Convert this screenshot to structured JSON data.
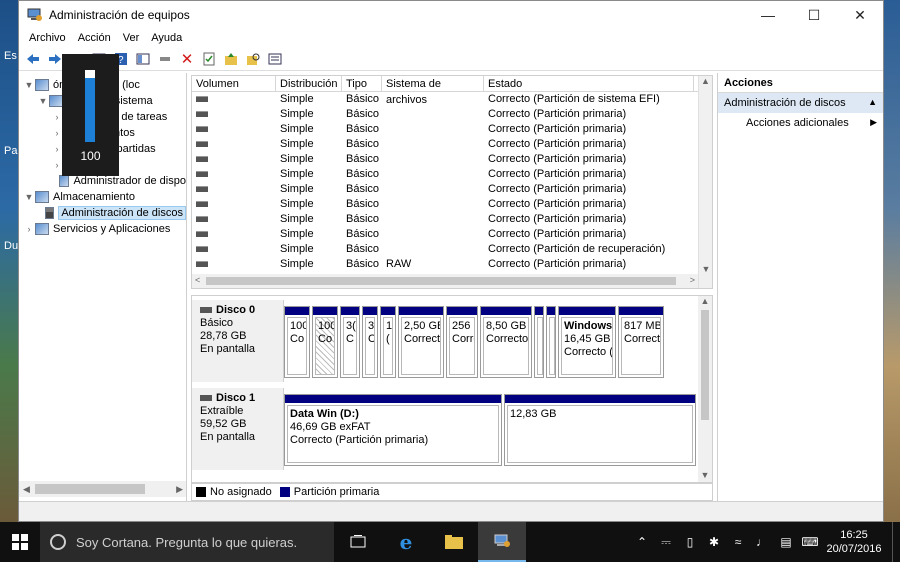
{
  "window": {
    "title": "Administración de equipos"
  },
  "desktop": {
    "left_labels": [
      "Es",
      "Pa",
      "Du"
    ]
  },
  "menu": [
    "Archivo",
    "Acción",
    "Ver",
    "Ayuda"
  ],
  "volume_osd": {
    "value": "100",
    "level": 1.0
  },
  "tree": [
    {
      "label": "ón del equipo (loc",
      "arrow": "▼",
      "icon": "computer-icon",
      "indent": 0
    },
    {
      "label": "entas del sistema",
      "arrow": "▼",
      "icon": "tools-icon",
      "indent": 1
    },
    {
      "label": "amador de tareas",
      "arrow": "›",
      "icon": "clock-icon",
      "indent": 2
    },
    {
      "label": "de eventos",
      "arrow": "›",
      "icon": "event-icon",
      "indent": 2
    },
    {
      "label": "as compartidas",
      "arrow": "›",
      "icon": "folder-icon",
      "indent": 2
    },
    {
      "label": "miento",
      "arrow": "›",
      "icon": "perf-icon",
      "indent": 2
    },
    {
      "label": "Administrador de dispo",
      "arrow": "",
      "icon": "device-icon",
      "indent": 2
    },
    {
      "label": "Almacenamiento",
      "arrow": "▼",
      "icon": "storage-icon",
      "indent": 0
    },
    {
      "label": "Administración de discos",
      "arrow": "",
      "icon": "disk-icon",
      "indent": 1,
      "selected": true
    },
    {
      "label": "Servicios y Aplicaciones",
      "arrow": "›",
      "icon": "services-icon",
      "indent": 0
    }
  ],
  "volumes": {
    "headers": [
      "Volumen",
      "Distribución",
      "Tipo",
      "Sistema de archivos",
      "Estado"
    ],
    "rows": [
      [
        "",
        "Simple",
        "Básico",
        "",
        "Correcto (Partición de sistema EFI)"
      ],
      [
        "",
        "Simple",
        "Básico",
        "",
        "Correcto (Partición primaria)"
      ],
      [
        "",
        "Simple",
        "Básico",
        "",
        "Correcto (Partición primaria)"
      ],
      [
        "",
        "Simple",
        "Básico",
        "",
        "Correcto (Partición primaria)"
      ],
      [
        "",
        "Simple",
        "Básico",
        "",
        "Correcto (Partición primaria)"
      ],
      [
        "",
        "Simple",
        "Básico",
        "",
        "Correcto (Partición primaria)"
      ],
      [
        "",
        "Simple",
        "Básico",
        "",
        "Correcto (Partición primaria)"
      ],
      [
        "",
        "Simple",
        "Básico",
        "",
        "Correcto (Partición primaria)"
      ],
      [
        "",
        "Simple",
        "Básico",
        "",
        "Correcto (Partición primaria)"
      ],
      [
        "",
        "Simple",
        "Básico",
        "",
        "Correcto (Partición primaria)"
      ],
      [
        "",
        "Simple",
        "Básico",
        "",
        "Correcto (Partición de recuperación)"
      ],
      [
        "",
        "Simple",
        "Básico",
        "RAW",
        "Correcto (Partición primaria)"
      ]
    ]
  },
  "disks": [
    {
      "name": "Disco 0",
      "type": "Básico",
      "size": "28,78 GB",
      "status": "En pantalla",
      "partitions": [
        {
          "l1": "100",
          "l2": "Co",
          "w": 26
        },
        {
          "l1": "100",
          "l2": "Co",
          "w": 26,
          "hatched": true
        },
        {
          "l1": "3(",
          "l2": "C",
          "w": 20
        },
        {
          "l1": "3(",
          "l2": "C",
          "w": 16
        },
        {
          "l1": "1",
          "l2": "(",
          "w": 16
        },
        {
          "l1": "2,50 GB",
          "l2": "Correct",
          "w": 46
        },
        {
          "l1": "256 I",
          "l2": "Corre",
          "w": 32
        },
        {
          "l1": "8,50 GB",
          "l2": "Correcto",
          "w": 52
        },
        {
          "l1": "",
          "l2": "",
          "w": 10
        },
        {
          "l1": "",
          "l2": "",
          "w": 10
        },
        {
          "l0": "Windows",
          "l1": "16,45 GB N",
          "l2": "Correcto (",
          "w": 58
        },
        {
          "l1": "817 MB",
          "l2": "Correct",
          "w": 46
        }
      ]
    },
    {
      "name": "Disco 1",
      "type": "Extraíble",
      "size": "59,52 GB",
      "status": "En pantalla",
      "partitions": [
        {
          "l0": "Data Win  (D:)",
          "l1": "46,69 GB exFAT",
          "l2": "Correcto (Partición primaria)",
          "w": 218
        },
        {
          "l0": "",
          "l1": "12,83 GB",
          "l2": "",
          "w": 192
        }
      ]
    }
  ],
  "legend": [
    {
      "label": "No asignado",
      "color": "#000000"
    },
    {
      "label": "Partición primaria",
      "color": "#000080"
    }
  ],
  "actions": {
    "header": "Acciones",
    "section": "Administración de discos",
    "item": "Acciones adicionales"
  },
  "taskbar": {
    "search_placeholder": "Soy Cortana. Pregunta lo que quieras.",
    "time": "16:25",
    "date": "20/07/2016"
  }
}
